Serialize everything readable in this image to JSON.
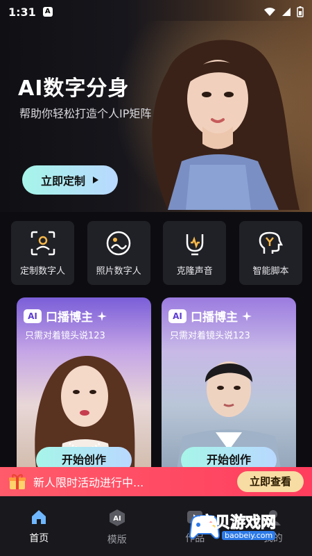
{
  "status": {
    "time": "1:31",
    "notif": "A"
  },
  "hero": {
    "title": "AI数字分身",
    "subtitle": "帮助你轻松打造个人IP矩阵",
    "cta_label": "立即定制"
  },
  "tools": [
    {
      "label": "定制数字人",
      "icon": "face-scan-icon"
    },
    {
      "label": "照片数字人",
      "icon": "photo-avatar-icon"
    },
    {
      "label": "克隆声音",
      "icon": "voice-clone-icon"
    },
    {
      "label": "智能脚本",
      "icon": "smart-script-icon"
    }
  ],
  "cards": [
    {
      "badge": "AI",
      "title": "口播博主",
      "subtitle": "只需对着镜头说123",
      "button": "开始创作"
    },
    {
      "badge": "AI",
      "title": "口播博主",
      "subtitle": "只需对着镜头说123",
      "button": "开始创作"
    }
  ],
  "promo": {
    "text": "新人限时活动进行中...",
    "button": "立即查看"
  },
  "tabs": [
    {
      "label": "首页",
      "icon": "home-icon",
      "active": true
    },
    {
      "label": "模版",
      "icon": "ai-template-icon",
      "active": false
    },
    {
      "label": "作品",
      "icon": "works-icon",
      "active": false
    },
    {
      "label": "我的",
      "icon": "profile-icon",
      "active": false
    }
  ],
  "watermark": {
    "text": "宝贝游戏网",
    "url": "baobeiy.com"
  },
  "colors": {
    "accent_gradient_start": "#a6f5e9",
    "accent_gradient_end": "#b9d8ff",
    "promo": "#ff4a63",
    "promo_button": "#f7dca4"
  }
}
